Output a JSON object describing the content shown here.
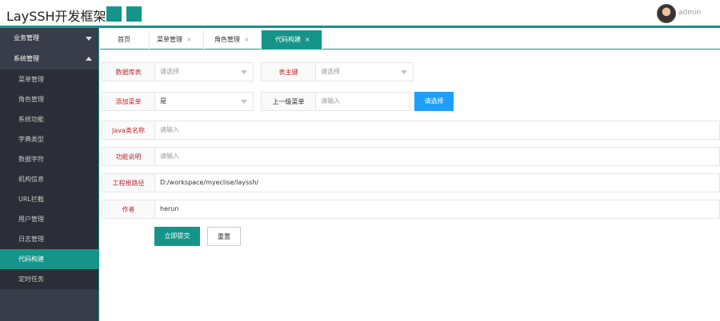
{
  "header": {
    "brand": "LaySSH开发框架",
    "user": "admin"
  },
  "sidebar": {
    "groups": [
      {
        "label": "业务管理"
      },
      {
        "label": "系统管理"
      }
    ],
    "items": [
      "菜单管理",
      "角色管理",
      "系统功能",
      "字典类型",
      "数据字符",
      "机构信息",
      "URL拦截",
      "用户管理",
      "日志管理",
      "代码构建",
      "定时任务"
    ],
    "active_item": "代码构建"
  },
  "tabs": [
    {
      "label": "首页"
    },
    {
      "label": "菜单管理",
      "close": "×"
    },
    {
      "label": "角色管理",
      "close": "×"
    },
    {
      "label": "代码构建",
      "close": "×"
    }
  ],
  "form": {
    "db_table": {
      "label": "数据库表",
      "placeholder": "请选择"
    },
    "pk": {
      "label": "表主键",
      "placeholder": "请选择"
    },
    "add_menu": {
      "label": "添加菜单",
      "value": "是"
    },
    "parent_menu": {
      "label": "上一级菜单",
      "placeholder": "请输入",
      "button": "请选择"
    },
    "java_class": {
      "label": "Java类名称",
      "placeholder": "请输入"
    },
    "func_desc": {
      "label": "功能说明",
      "placeholder": "请输入"
    },
    "root_path": {
      "label": "工程根路径",
      "value": "D:/workspace/myeclise/layssh/"
    },
    "author": {
      "label": "作者",
      "value": "herun"
    },
    "submit": "立即提交",
    "reset": "重置"
  },
  "colors": {
    "accent": "#15958a",
    "sidebar": "#393d49",
    "blue": "#1e9fff",
    "required": "#c0282d"
  }
}
